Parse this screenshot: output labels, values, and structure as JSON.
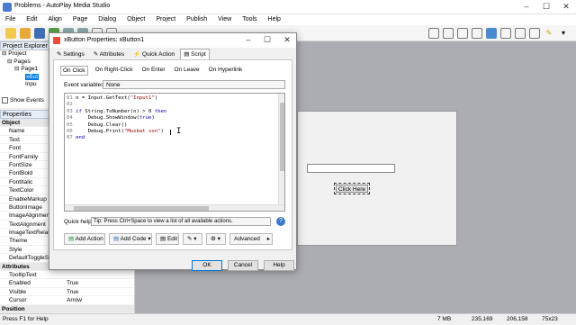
{
  "app": {
    "title": "Problems - AutoPlay Media Studio"
  },
  "menu": [
    "File",
    "Edit",
    "Align",
    "Page",
    "Dialog",
    "Object",
    "Project",
    "Publish",
    "View",
    "Tools",
    "Help"
  ],
  "explorer": {
    "title": "Project Explorer",
    "tree": [
      "Project",
      "Pages",
      "Page1",
      "xBut",
      "Inpu"
    ],
    "show_events": "Show Events"
  },
  "properties": {
    "title": "Properties",
    "rows": [
      {
        "k": "Object",
        "v": "",
        "cat": true
      },
      {
        "k": "Name",
        "v": ""
      },
      {
        "k": "Text",
        "v": ""
      },
      {
        "k": "Font",
        "v": ""
      },
      {
        "k": "FontFamily",
        "v": ""
      },
      {
        "k": "FontSize",
        "v": ""
      },
      {
        "k": "FontBold",
        "v": ""
      },
      {
        "k": "FontItalic",
        "v": ""
      },
      {
        "k": "TextColor",
        "v": ""
      },
      {
        "k": "EnableMarkup",
        "v": ""
      },
      {
        "k": "ButtonImage",
        "v": ""
      },
      {
        "k": "ImageAlignment",
        "v": ""
      },
      {
        "k": "TextAlignment",
        "v": ""
      },
      {
        "k": "ImageTextRelatio",
        "v": ""
      },
      {
        "k": "Theme",
        "v": ""
      },
      {
        "k": "Style",
        "v": ""
      },
      {
        "k": "DefaultToggleSta",
        "v": ""
      },
      {
        "k": "Attributes",
        "v": "",
        "cat": true
      },
      {
        "k": "TooltipText",
        "v": ""
      },
      {
        "k": "Enabled",
        "v": "True"
      },
      {
        "k": "Visible",
        "v": "True"
      },
      {
        "k": "Cursor",
        "v": "Arrow"
      },
      {
        "k": "Position",
        "v": "",
        "cat": true
      }
    ]
  },
  "dialog": {
    "title": "xButton Properties: xButton1",
    "tabs": [
      "Settings",
      "Attributes",
      "Quick Action",
      "Script"
    ],
    "subtabs": [
      "On Click",
      "On Right-Click",
      "On Enter",
      "On Leave",
      "On Hyperlink"
    ],
    "event_vars_label": "Event variables:",
    "event_vars_value": "None",
    "code": [
      {
        "n": "01",
        "t": "n = Input.GetText(\"Input1\")"
      },
      {
        "n": "02",
        "t": ""
      },
      {
        "n": "03",
        "t": "if String.ToNumber(n) > 0 then"
      },
      {
        "n": "04",
        "t": "    Debug.ShowWindow(true)"
      },
      {
        "n": "05",
        "t": "    Debug.Clear()"
      },
      {
        "n": "06",
        "t": "    Debug.Print(\"Musbat son\")"
      },
      {
        "n": "07",
        "t": "end"
      }
    ],
    "quick_help_label": "Quick help:",
    "quick_help_text": "Tip: Press Ctrl+Space to view a list of all available actions.",
    "action_buttons": [
      "Add Action",
      "Add Code",
      "Edit",
      "",
      "",
      "Advanced"
    ],
    "ok": "OK",
    "cancel": "Cancel",
    "help": "Help"
  },
  "canvas": {
    "button_text": "Click Here"
  },
  "status": {
    "help": "Press F1 for Help",
    "memory": "7 MB",
    "pos": "235,169",
    "obj_pos": "206,158",
    "size": "75x23"
  }
}
